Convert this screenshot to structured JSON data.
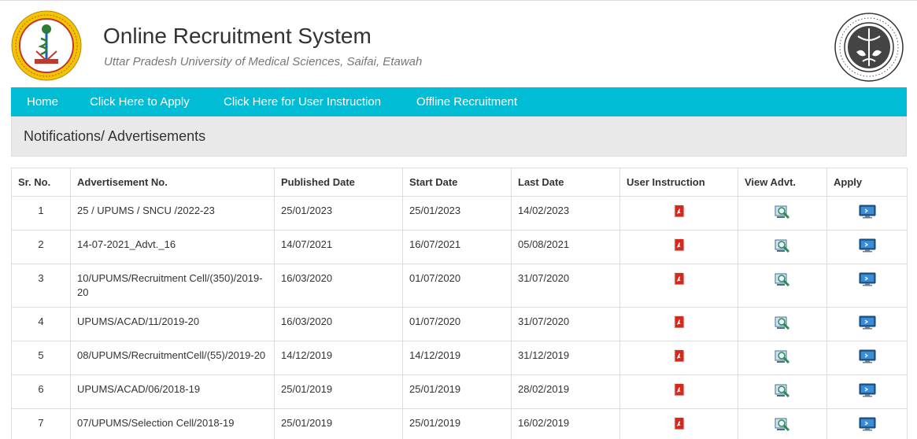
{
  "header": {
    "title": "Online Recruitment System",
    "subtitle": "Uttar Pradesh University of Medical Sciences, Saifai, Etawah",
    "logo_left_icon": "university-seal-icon",
    "logo_right_icon": "up-government-emblem-icon"
  },
  "nav": {
    "items": [
      {
        "label": "Home"
      },
      {
        "label": "Click Here to Apply"
      },
      {
        "label": "Click Here for User Instruction"
      },
      {
        "label": "Offline Recruitment"
      }
    ]
  },
  "panel": {
    "title": "Notifications/ Advertisements"
  },
  "table": {
    "headers": [
      "Sr. No.",
      "Advertisement No.",
      "Published Date",
      "Start Date",
      "Last Date",
      "User Instruction",
      "View Advt.",
      "Apply"
    ],
    "icons": {
      "instruction": "pdf-icon",
      "view": "magnifier-icon",
      "apply": "monitor-icon"
    },
    "colors": {
      "pdf": "#d42a1e",
      "apply": "#1f5f9e",
      "view": "#2e8b57"
    },
    "rows": [
      {
        "sr": "1",
        "adv_no": "25 / UPUMS / SNCU /2022-23",
        "published": "25/01/2023",
        "start": "25/01/2023",
        "last": "14/02/2023"
      },
      {
        "sr": "2",
        "adv_no": "14-07-2021_Advt._16",
        "published": "14/07/2021",
        "start": "16/07/2021",
        "last": "05/08/2021"
      },
      {
        "sr": "3",
        "adv_no": "10/UPUMS/Recruitment Cell/(350)/2019-20",
        "published": "16/03/2020",
        "start": "01/07/2020",
        "last": "31/07/2020"
      },
      {
        "sr": "4",
        "adv_no": "UPUMS/ACAD/11/2019-20",
        "published": "16/03/2020",
        "start": "01/07/2020",
        "last": "31/07/2020"
      },
      {
        "sr": "5",
        "adv_no": "08/UPUMS/RecruitmentCell/(55)/2019-20",
        "published": "14/12/2019",
        "start": "14/12/2019",
        "last": "31/12/2019"
      },
      {
        "sr": "6",
        "adv_no": "UPUMS/ACAD/06/2018-19",
        "published": "25/01/2019",
        "start": "25/01/2019",
        "last": "28/02/2019"
      },
      {
        "sr": "7",
        "adv_no": "07/UPUMS/Selection Cell/2018-19",
        "published": "25/01/2019",
        "start": "25/01/2019",
        "last": "16/02/2019"
      }
    ]
  }
}
